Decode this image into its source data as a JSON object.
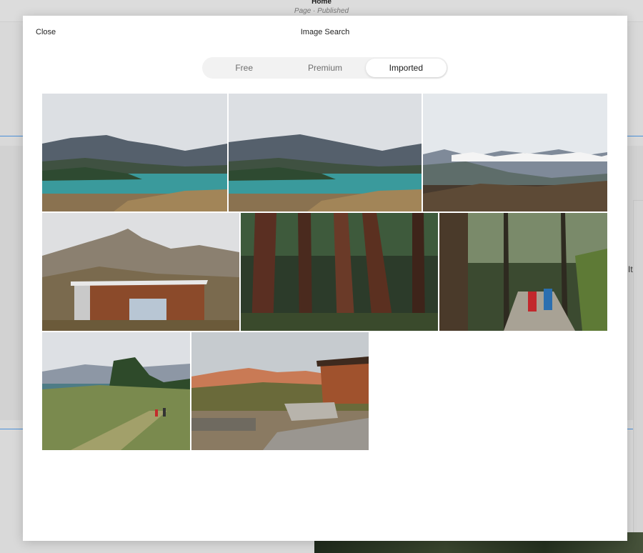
{
  "background_page": {
    "title": "Home",
    "subtitle": "Page · Published",
    "side_text": "It"
  },
  "modal": {
    "close_label": "Close",
    "title": "Image Search",
    "tabs": [
      {
        "label": "Free",
        "active": false
      },
      {
        "label": "Premium",
        "active": false
      },
      {
        "label": "Imported",
        "active": true
      }
    ],
    "images": [
      {
        "subject": "mountain lake"
      },
      {
        "subject": "mountain lake"
      },
      {
        "subject": "snowy mountain range"
      },
      {
        "subject": "wooden cabin with mountain"
      },
      {
        "subject": "redwood forest"
      },
      {
        "subject": "hikers on forest trail"
      },
      {
        "subject": "hikers in meadow"
      },
      {
        "subject": "lodge at dusk"
      }
    ]
  },
  "colors": {
    "accent": "#4a90d9",
    "overlay": "#d9d9d9",
    "modal_bg": "#ffffff",
    "segmented_bg": "#f2f2f2"
  }
}
